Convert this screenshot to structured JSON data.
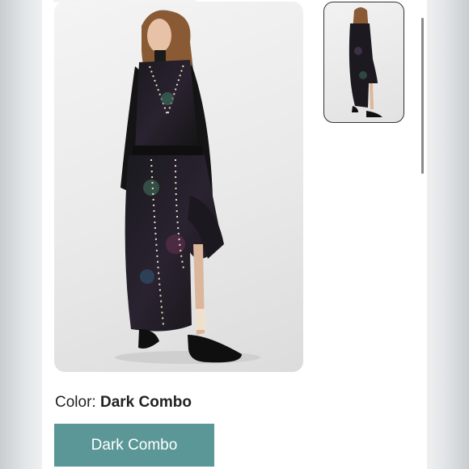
{
  "product": {
    "main_image_alt": "Model wearing dark printed studded maxi dress",
    "thumbnail_alt": "Dress thumbnail"
  },
  "color_selector": {
    "label": "Color:",
    "selected_value": "Dark Combo",
    "options": [
      "Dark Combo"
    ]
  },
  "colors": {
    "swatch_button_bg": "#5b9797",
    "swatch_button_text": "#ffffff"
  }
}
